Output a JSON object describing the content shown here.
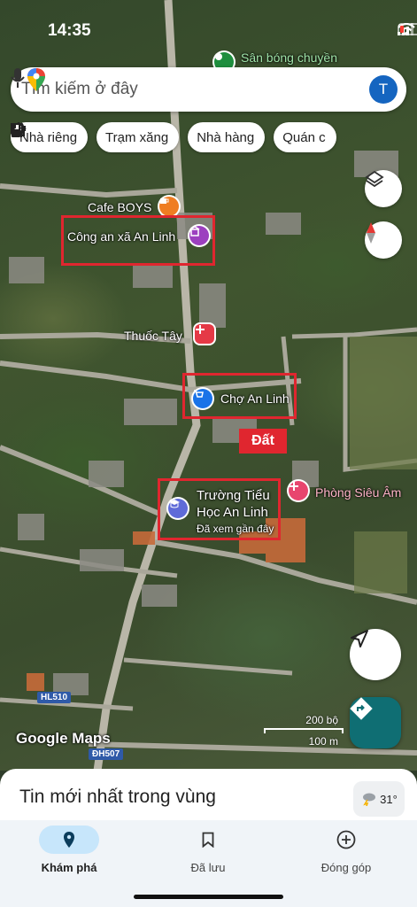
{
  "status": {
    "time": "14:35"
  },
  "search": {
    "placeholder": "Tìm kiếm ở đây",
    "avatar_letter": "T"
  },
  "chips": [
    {
      "label": "Nhà riêng",
      "icon": "home-icon"
    },
    {
      "label": "Trạm xăng",
      "icon": "gas-station-icon"
    },
    {
      "label": "Nhà hàng",
      "icon": "restaurant-icon"
    },
    {
      "label": "Quán c",
      "icon": "cafe-icon"
    }
  ],
  "map": {
    "places": {
      "san_bong": "Sân bóng chuyền",
      "cafe": "Cafe BOYS",
      "cong_an": "Công an xã An Linh",
      "thuoc": "Thuốc Tây",
      "cho": "Chợ An Linh",
      "dat": "Đất",
      "phong_sieu_am": "Phòng Siêu Âm",
      "truong_line1": "Trường Tiểu",
      "truong_line2": "Học An Linh",
      "truong_sub": "Đã xem gần đây"
    },
    "roads": {
      "hl510": "HL510",
      "dh507": "ĐH507"
    },
    "google_logo": "Google Maps",
    "scale": {
      "imperial": "200 bộ",
      "metric": "100 m"
    }
  },
  "sheet": {
    "title": "Tin mới nhất trong vùng",
    "temperature": "31°"
  },
  "nav": [
    {
      "label": "Khám phá",
      "icon": "explore-pin-icon",
      "active": true
    },
    {
      "label": "Đã lưu",
      "icon": "bookmark-icon",
      "active": false
    },
    {
      "label": "Đóng góp",
      "icon": "add-circle-icon",
      "active": false
    }
  ]
}
